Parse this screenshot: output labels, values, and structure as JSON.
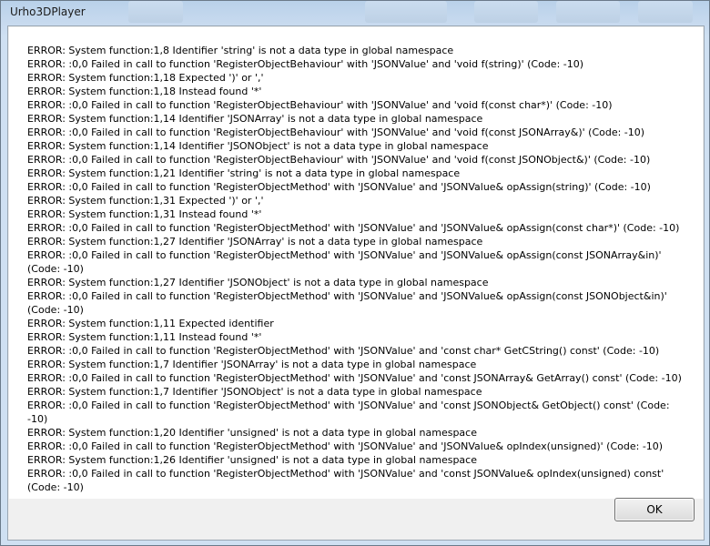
{
  "window": {
    "title": "Urho3DPlayer"
  },
  "dialog": {
    "ok_label": "OK",
    "lines": [
      "ERROR: System function:1,8 Identifier 'string' is not a data type in global namespace",
      "ERROR: :0,0 Failed in call to function 'RegisterObjectBehaviour' with 'JSONValue' and 'void f(string)' (Code: -10)",
      "ERROR: System function:1,18 Expected ')' or ','",
      "ERROR: System function:1,18 Instead found '*'",
      "ERROR: :0,0 Failed in call to function 'RegisterObjectBehaviour' with 'JSONValue' and 'void f(const char*)' (Code: -10)",
      "ERROR: System function:1,14 Identifier 'JSONArray' is not a data type in global namespace",
      "ERROR: :0,0 Failed in call to function 'RegisterObjectBehaviour' with 'JSONValue' and 'void f(const JSONArray&)' (Code: -10)",
      "ERROR: System function:1,14 Identifier 'JSONObject' is not a data type in global namespace",
      "ERROR: :0,0 Failed in call to function 'RegisterObjectBehaviour' with 'JSONValue' and 'void f(const JSONObject&)' (Code: -10)",
      "ERROR: System function:1,21 Identifier 'string' is not a data type in global namespace",
      "ERROR: :0,0 Failed in call to function 'RegisterObjectMethod' with 'JSONValue' and 'JSONValue& opAssign(string)' (Code: -10)",
      "ERROR: System function:1,31 Expected ')' or ','",
      "ERROR: System function:1,31 Instead found '*'",
      "ERROR: :0,0 Failed in call to function 'RegisterObjectMethod' with 'JSONValue' and 'JSONValue& opAssign(const char*)' (Code: -10)",
      "ERROR: System function:1,27 Identifier 'JSONArray' is not a data type in global namespace",
      "ERROR: :0,0 Failed in call to function 'RegisterObjectMethod' with 'JSONValue' and 'JSONValue& opAssign(const JSONArray&in)' (Code: -10)",
      "ERROR: System function:1,27 Identifier 'JSONObject' is not a data type in global namespace",
      "ERROR: :0,0 Failed in call to function 'RegisterObjectMethod' with 'JSONValue' and 'JSONValue& opAssign(const JSONObject&in)' (Code: -10)",
      "ERROR: System function:1,11 Expected identifier",
      "ERROR: System function:1,11 Instead found '*'",
      "ERROR: :0,0 Failed in call to function 'RegisterObjectMethod' with 'JSONValue' and 'const char* GetCString() const' (Code: -10)",
      "ERROR: System function:1,7 Identifier 'JSONArray' is not a data type in global namespace",
      "ERROR: :0,0 Failed in call to function 'RegisterObjectMethod' with 'JSONValue' and 'const JSONArray& GetArray() const' (Code: -10)",
      "ERROR: System function:1,7 Identifier 'JSONObject' is not a data type in global namespace",
      "ERROR: :0,0 Failed in call to function 'RegisterObjectMethod' with 'JSONValue' and 'const JSONObject& GetObject() const' (Code: -10)",
      "ERROR: System function:1,20 Identifier 'unsigned' is not a data type in global namespace",
      "ERROR: :0,0 Failed in call to function 'RegisterObjectMethod' with 'JSONValue' and 'JSONValue& opIndex(unsigned)' (Code: -10)",
      "ERROR: System function:1,26 Identifier 'unsigned' is not a data type in global namespace",
      "ERROR: :0,0 Failed in call to function 'RegisterObjectMethod' with 'JSONValue' and 'const JSONValue& opIndex(unsigned) const' (Code: -10)"
    ]
  }
}
